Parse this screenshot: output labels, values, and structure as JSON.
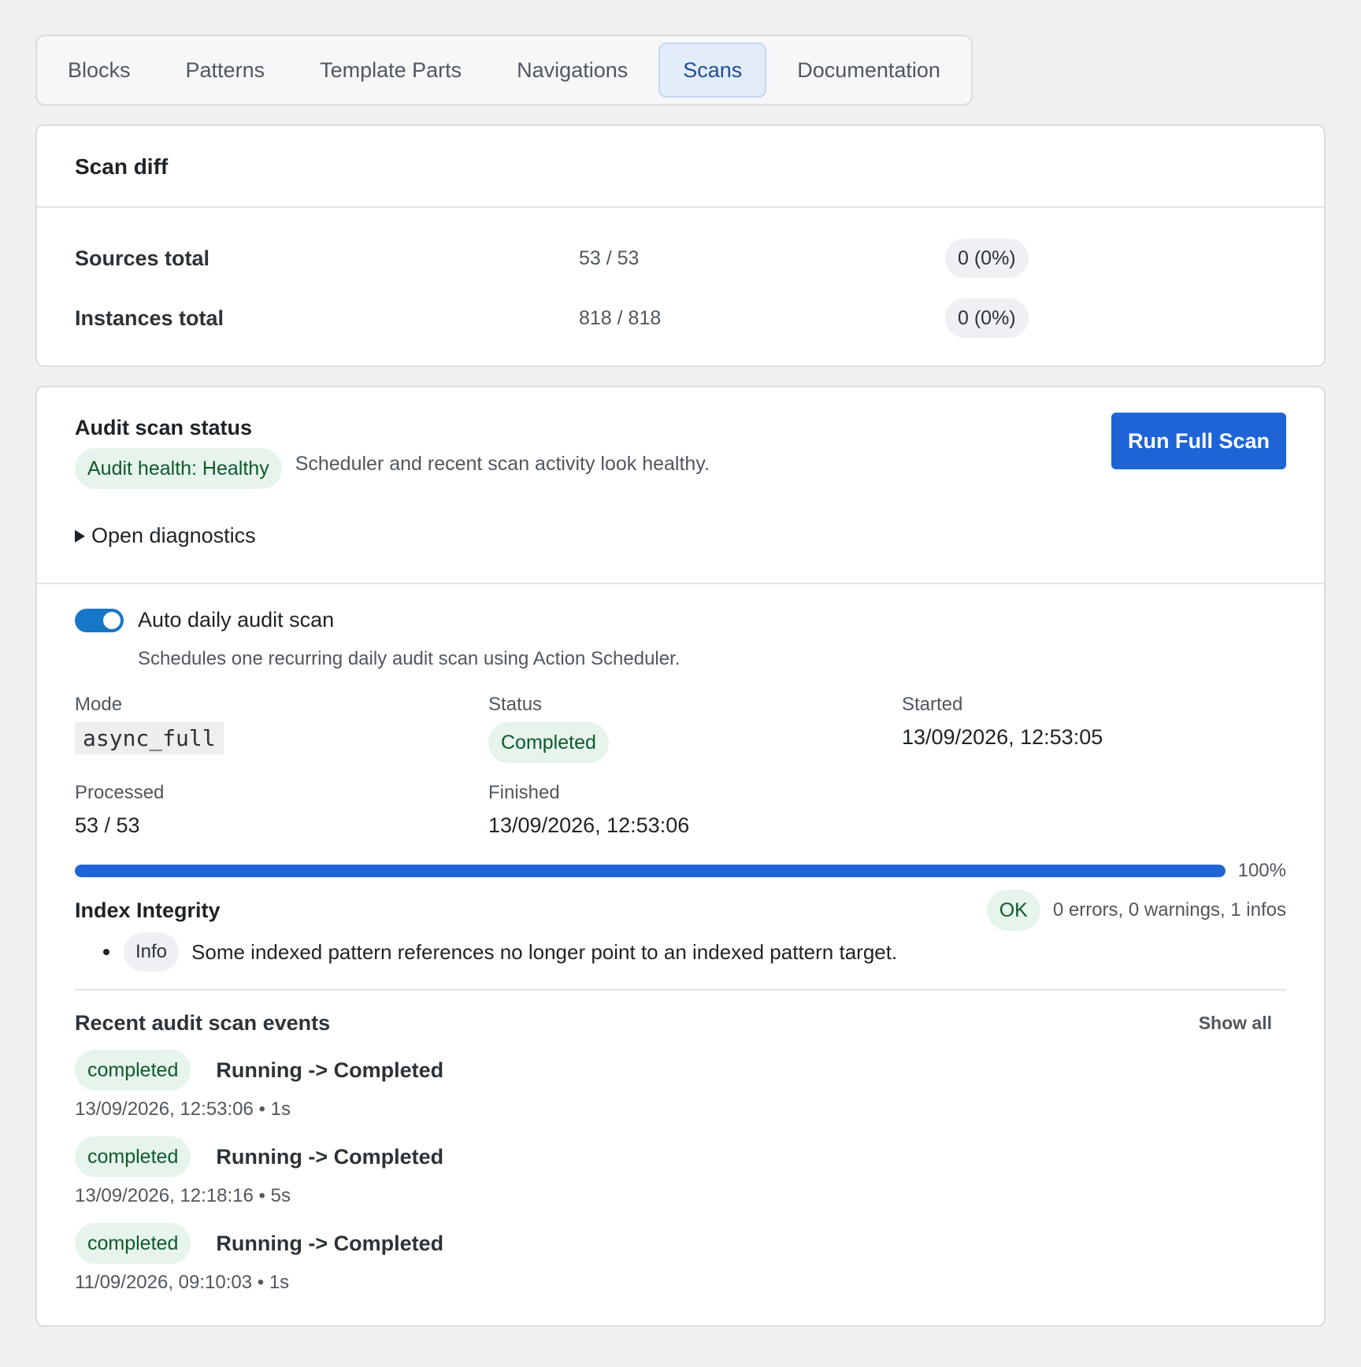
{
  "tabs": [
    {
      "label": "Blocks",
      "active": false
    },
    {
      "label": "Patterns",
      "active": false
    },
    {
      "label": "Template Parts",
      "active": false
    },
    {
      "label": "Navigations",
      "active": false
    },
    {
      "label": "Scans",
      "active": true
    },
    {
      "label": "Documentation",
      "active": false
    }
  ],
  "scan_diff": {
    "title": "Scan diff",
    "rows": [
      {
        "label": "Sources total",
        "value": "53 / 53",
        "delta": "0 (0%)"
      },
      {
        "label": "Instances total",
        "value": "818 / 818",
        "delta": "0 (0%)"
      }
    ]
  },
  "audit": {
    "title": "Audit scan status",
    "health_badge": "Audit health: Healthy",
    "health_desc": "Scheduler and recent scan activity look healthy.",
    "run_button": "Run Full Scan",
    "diagnostics_label": "Open diagnostics",
    "auto_label": "Auto daily audit scan",
    "auto_enabled": true,
    "auto_help": "Schedules one recurring daily audit scan using Action Scheduler.",
    "mode_label": "Mode",
    "mode_value": "async_full",
    "status_label": "Status",
    "status_value": "Completed",
    "started_label": "Started",
    "started_value": "13/09/2026, 12:53:05",
    "processed_label": "Processed",
    "processed_value": "53 / 53",
    "finished_label": "Finished",
    "finished_value": "13/09/2026, 12:53:06",
    "progress_percent": 100,
    "progress_label": "100%"
  },
  "integrity": {
    "title": "Index Integrity",
    "status": "OK",
    "summary": "0 errors, 0 warnings, 1 infos",
    "issues": [
      {
        "level": "Info",
        "text": "Some indexed pattern references no longer point to an indexed pattern target."
      }
    ]
  },
  "events": {
    "title": "Recent audit scan events",
    "show_all": "Show all",
    "items": [
      {
        "status": "completed",
        "transition": "Running -> Completed",
        "meta": "13/09/2026, 12:53:06 • 1s"
      },
      {
        "status": "completed",
        "transition": "Running -> Completed",
        "meta": "13/09/2026, 12:18:16 • 5s"
      },
      {
        "status": "completed",
        "transition": "Running -> Completed",
        "meta": "11/09/2026, 09:10:03 • 1s"
      }
    ]
  },
  "colors": {
    "accent": "#1f64d6",
    "toggle_on": "#1677c8",
    "success_bg": "#e7f4ec",
    "success_text": "#0f5a2b"
  }
}
